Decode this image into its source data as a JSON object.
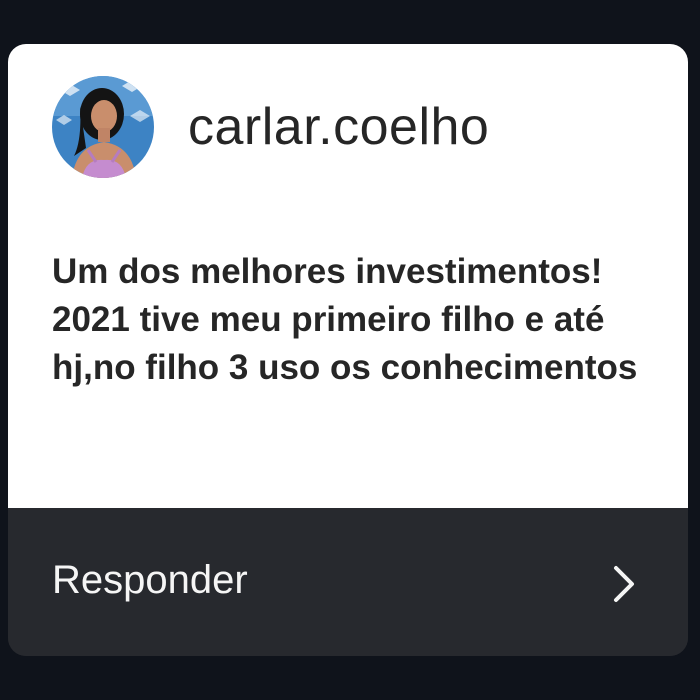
{
  "card": {
    "username": "carlar.coelho",
    "message": "Um dos melhores investimentos! 2021 tive meu primeiro filho e até hj,no filho 3 uso os conhecimentos",
    "avatar": {
      "icon": "profile-photo-avatar",
      "ring_color": "#e0e0e0"
    }
  },
  "reply": {
    "label": "Responder",
    "icon": "chevron-right-icon"
  },
  "colors": {
    "background": "#0f131b",
    "card": "#ffffff",
    "reply_bar": "#27292e",
    "text_dark": "#262626",
    "text_light": "#f5f5f5"
  }
}
